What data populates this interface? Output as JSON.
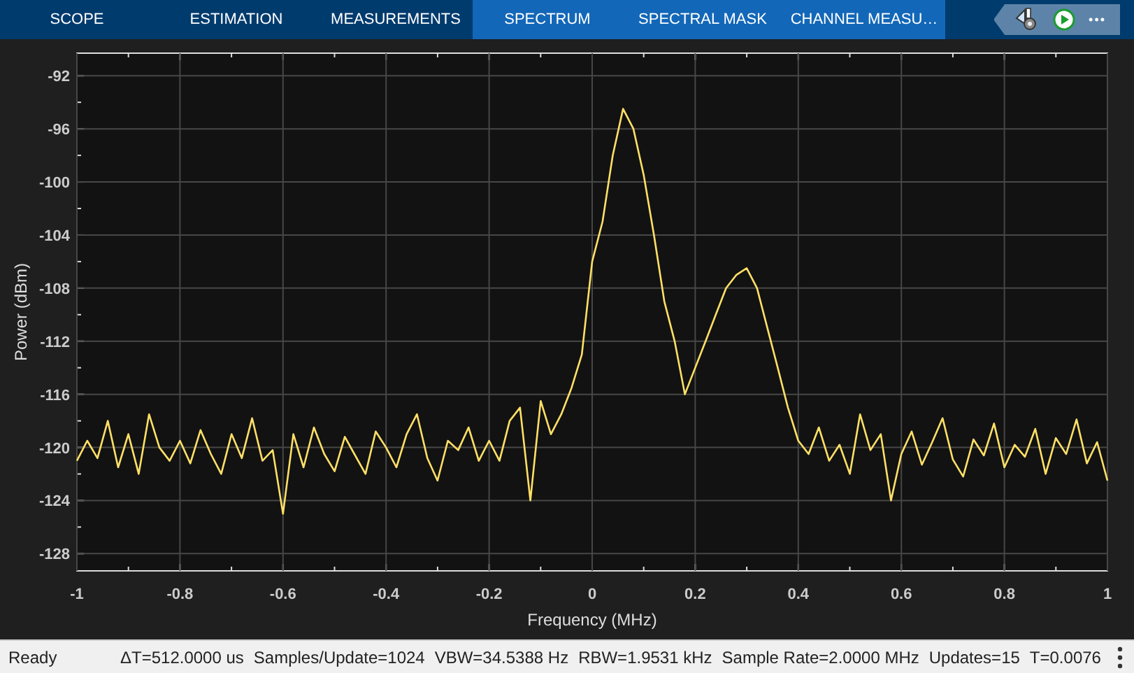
{
  "tabs": [
    {
      "label": "SCOPE",
      "kind": "main"
    },
    {
      "label": "ESTIMATION",
      "kind": "main"
    },
    {
      "label": "MEASUREMENTS",
      "kind": "main"
    },
    {
      "label": "SPECTRUM",
      "kind": "contextual"
    },
    {
      "label": "SPECTRAL MASK",
      "kind": "contextual"
    },
    {
      "label": "CHANNEL MEASU…",
      "kind": "contextual"
    }
  ],
  "toolbar": {
    "more": "•••"
  },
  "plot": {
    "chart_data": {
      "type": "line",
      "grid": true,
      "xlabel": "Frequency (MHz)",
      "ylabel": "Power (dBm)",
      "xlim": [
        -1,
        1
      ],
      "ylim": [
        -129.3,
        -90.3
      ],
      "xticks": [
        -1,
        -0.8,
        -0.6,
        -0.4,
        -0.2,
        0,
        0.2,
        0.4,
        0.6,
        0.8,
        1
      ],
      "yticks": [
        -92,
        -96,
        -100,
        -104,
        -108,
        -112,
        -116,
        -120,
        -124,
        -128
      ],
      "x": [
        -1,
        -0.98,
        -0.96,
        -0.94,
        -0.92,
        -0.9,
        -0.88,
        -0.86,
        -0.84,
        -0.82,
        -0.8,
        -0.78,
        -0.76,
        -0.74,
        -0.72,
        -0.7,
        -0.68,
        -0.66,
        -0.64,
        -0.62,
        -0.6,
        -0.58,
        -0.56,
        -0.54,
        -0.52,
        -0.5,
        -0.48,
        -0.46,
        -0.44,
        -0.42,
        -0.4,
        -0.38,
        -0.36,
        -0.34,
        -0.32,
        -0.3,
        -0.28,
        -0.26,
        -0.24,
        -0.22,
        -0.2,
        -0.18,
        -0.16,
        -0.14,
        -0.12,
        -0.1,
        -0.08,
        -0.06,
        -0.04,
        -0.02,
        0,
        0.02,
        0.04,
        0.06,
        0.08,
        0.1,
        0.12,
        0.14,
        0.16,
        0.18,
        0.2,
        0.22,
        0.24,
        0.26,
        0.28,
        0.3,
        0.32,
        0.34,
        0.36,
        0.38,
        0.4,
        0.42,
        0.44,
        0.46,
        0.48,
        0.5,
        0.52,
        0.54,
        0.56,
        0.58,
        0.6,
        0.62,
        0.64,
        0.66,
        0.68,
        0.7,
        0.72,
        0.74,
        0.76,
        0.78,
        0.8,
        0.82,
        0.84,
        0.86,
        0.88,
        0.9,
        0.92,
        0.94,
        0.96,
        0.98,
        1
      ],
      "series": [
        {
          "color": "#ffe066",
          "values": [
            -121,
            -119.5,
            -120.8,
            -118,
            -121.5,
            -119,
            -122,
            -117.5,
            -120,
            -121,
            -119.5,
            -121.2,
            -118.7,
            -120.5,
            -122,
            -119,
            -120.8,
            -117.8,
            -121,
            -120.2,
            -125,
            -119,
            -121.5,
            -118.5,
            -120.5,
            -121.8,
            -119.2,
            -120.6,
            -122,
            -118.8,
            -120,
            -121.5,
            -119,
            -117.5,
            -120.8,
            -122.5,
            -119.5,
            -120.2,
            -118.5,
            -121,
            -119.5,
            -121,
            -118,
            -117,
            -124,
            -116.5,
            -119,
            -117.5,
            -115.5,
            -113,
            -106,
            -103,
            -98,
            -94.5,
            -96,
            -99.5,
            -104,
            -109,
            -112,
            -116,
            -114,
            -112,
            -110,
            -108,
            -107,
            -106.5,
            -108,
            -111,
            -114,
            -117,
            -119.5,
            -120.5,
            -118.5,
            -121,
            -119.8,
            -122,
            -117.5,
            -120.2,
            -119,
            -124,
            -120.5,
            -118.8,
            -121.3,
            -119.6,
            -117.8,
            -120.9,
            -122.2,
            -119.4,
            -120.6,
            -118.2,
            -121.5,
            -119.8,
            -120.7,
            -118.6,
            -122,
            -119.3,
            -120.5,
            -117.9,
            -121.2,
            -119.6,
            -122.5
          ]
        }
      ]
    }
  },
  "status_bar": {
    "state": "Ready",
    "fields": [
      "ΔT=512.0000 us",
      "Samples/Update=1024",
      "VBW=34.5388 Hz",
      "RBW=1.9531 kHz",
      "Sample Rate=2.0000 MHz",
      "Updates=15",
      "T=0.0076"
    ]
  }
}
